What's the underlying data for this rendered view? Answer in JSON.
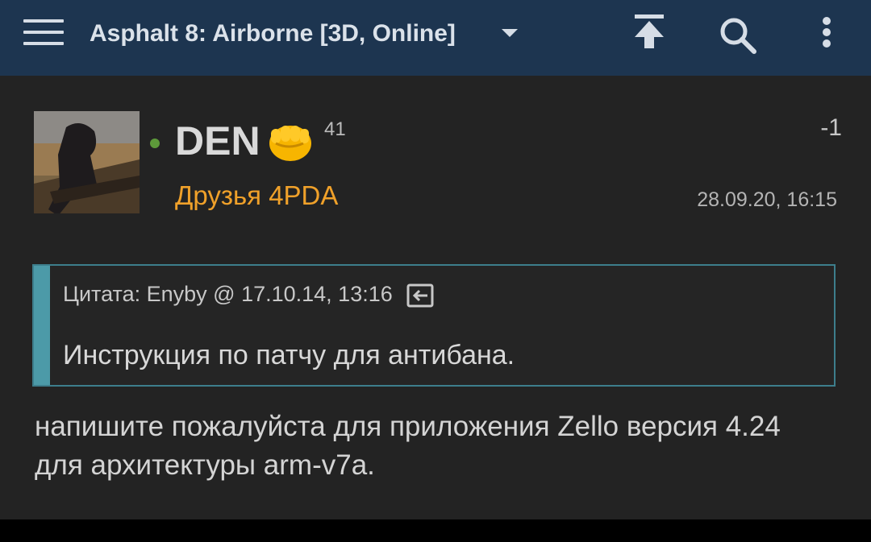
{
  "header": {
    "title": "Asphalt 8: Airborne [3D, Online]",
    "menu_icon": "hamburger-menu-icon",
    "dropdown_icon": "dropdown-arrow-icon",
    "actions": [
      "scroll-to-top-icon",
      "search-icon",
      "more-vert-icon"
    ]
  },
  "post": {
    "author": {
      "username": "DEN",
      "badge_icon": "fist-emoji-icon",
      "reputation": "41",
      "group": "Друзья 4PDA",
      "online": true
    },
    "rating": "-1",
    "timestamp": "28.09.20, 16:15",
    "quote": {
      "header": "Цитата: Enyby @ 17.10.14, 13:16",
      "text": "Инструкция по патчу для антибана."
    },
    "body": "напишите пожалуйста для приложения Zello версия 4.24 для архитектуры arm-v7a."
  },
  "colors": {
    "header_bg": "#1d3550",
    "page_bg": "#232323",
    "group": "#f0a12a",
    "online": "#5d9a3a",
    "quote_border": "#4c9aa8"
  }
}
